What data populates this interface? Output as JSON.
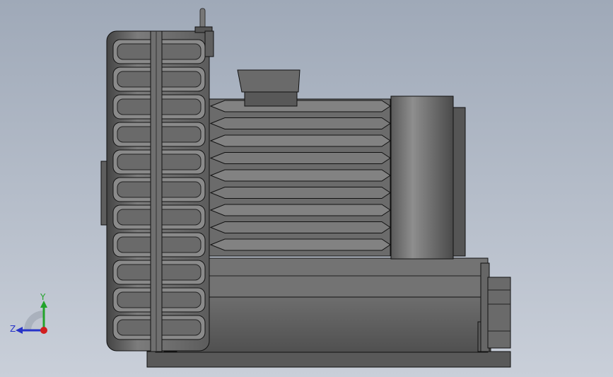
{
  "viewport": {
    "background_top": "#9fa9b8",
    "background_bottom": "#c9cfd9"
  },
  "model": {
    "part": "blower-assembly",
    "view": "side-view"
  },
  "triad": {
    "y_label": "Y",
    "z_label": "Z",
    "y_color": "#22a32a",
    "z_color": "#2733c8",
    "x_color": "#d11e1e"
  }
}
